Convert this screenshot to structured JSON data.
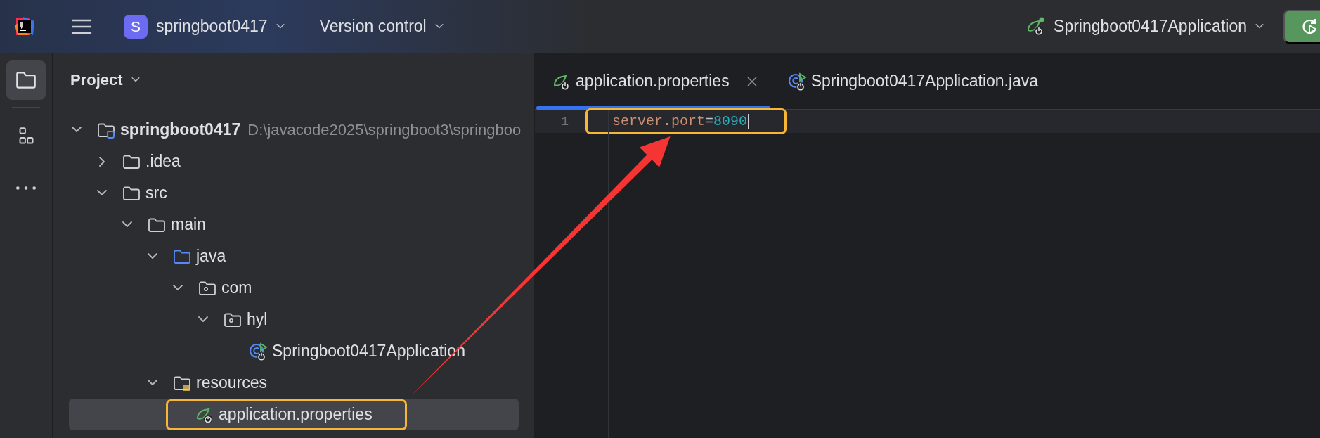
{
  "title_bar": {
    "project": {
      "badge": "S",
      "name": "springboot0417"
    },
    "vcs": "Version control",
    "run_config": "Springboot0417Application"
  },
  "tool_strip": [
    {
      "kind": "project",
      "selected": true
    },
    {
      "kind": "structure",
      "selected": false
    },
    {
      "kind": "more",
      "selected": false
    }
  ],
  "project_panel": {
    "title": "Project",
    "tree": [
      {
        "label": "springboot0417",
        "kind": "module",
        "path": "D:\\javacode2025\\springboot3\\springboo",
        "expanded": true,
        "selected": false,
        "children": [
          {
            "label": ".idea",
            "kind": "folder",
            "expanded": false,
            "selected": false
          },
          {
            "label": "src",
            "kind": "folder",
            "expanded": true,
            "selected": false,
            "children": [
              {
                "label": "main",
                "kind": "folder",
                "expanded": true,
                "selected": false,
                "children": [
                  {
                    "label": "java",
                    "kind": "source",
                    "expanded": true,
                    "selected": false,
                    "children": [
                      {
                        "label": "com",
                        "kind": "package",
                        "expanded": true,
                        "selected": false,
                        "children": [
                          {
                            "label": "hyl",
                            "kind": "package",
                            "expanded": true,
                            "selected": false,
                            "children": [
                              {
                                "label": "Springboot0417Application",
                                "kind": "spring-class",
                                "selected": false
                              }
                            ]
                          }
                        ]
                      }
                    ]
                  },
                  {
                    "label": "resources",
                    "kind": "resources",
                    "expanded": true,
                    "selected": false,
                    "children": [
                      {
                        "label": "application.properties",
                        "kind": "properties",
                        "selected": true,
                        "highlighted": true
                      }
                    ]
                  }
                ]
              }
            ]
          }
        ]
      }
    ]
  },
  "editor": {
    "tabs": [
      {
        "label": "application.properties",
        "kind": "properties",
        "selected": true,
        "closable": true
      },
      {
        "label": "Springboot0417Application.java",
        "kind": "spring-class",
        "selected": false,
        "closable": false
      }
    ],
    "lines": [
      {
        "number": "1",
        "current": true,
        "highlighted": true,
        "tokens": [
          {
            "kind": "key",
            "text": "server.port"
          },
          {
            "kind": "op",
            "text": "="
          },
          {
            "kind": "value",
            "text": "8090"
          }
        ]
      }
    ]
  },
  "annotations": [
    {
      "kind": "arrow"
    }
  ]
}
